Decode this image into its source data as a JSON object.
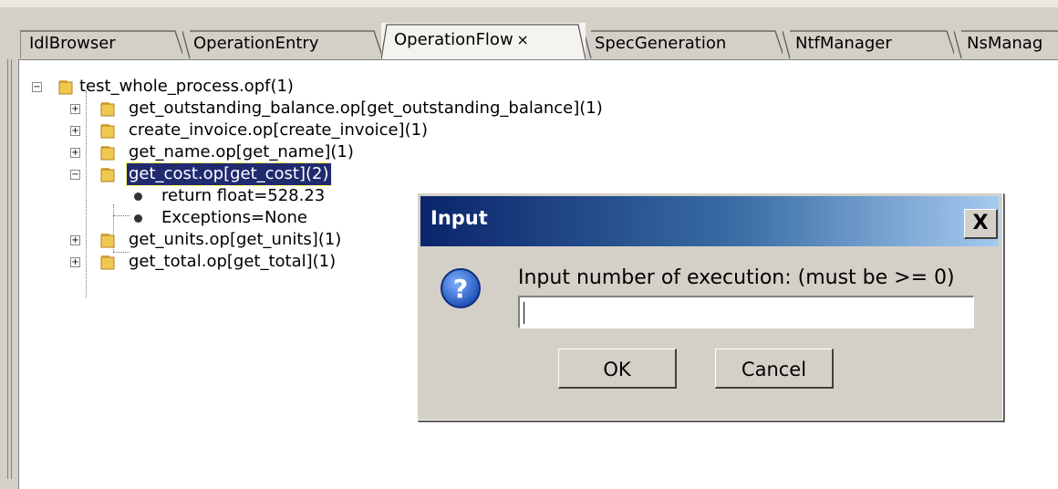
{
  "tabs": [
    {
      "label": "IdlBrowser",
      "active": false
    },
    {
      "label": "OperationEntry",
      "active": false
    },
    {
      "label": "OperationFlow",
      "active": true,
      "close": "×"
    },
    {
      "label": "SpecGeneration",
      "active": false
    },
    {
      "label": "NtfManager",
      "active": false
    },
    {
      "label": "NsManag",
      "active": false
    }
  ],
  "tree": {
    "root": "test_whole_process.opf(1)",
    "items": [
      {
        "label": "get_outstanding_balance.op[get_outstanding_balance](1)"
      },
      {
        "label": "create_invoice.op[create_invoice](1)"
      },
      {
        "label": "get_name.op[get_name](1)"
      },
      {
        "label": "get_cost.op[get_cost](2)",
        "selected": true,
        "children": [
          "return float=528.23",
          "Exceptions=None"
        ]
      },
      {
        "label": "get_units.op[get_units](1)"
      },
      {
        "label": "get_total.op[get_total](1)"
      }
    ]
  },
  "dialog": {
    "title": "Input",
    "close_glyph": "X",
    "icon": "question-icon",
    "prompt": "Input number of execution: (must be >= 0)",
    "input_value": "",
    "ok_label": "OK",
    "cancel_label": "Cancel"
  },
  "colors": {
    "selection": "#1f2a6f",
    "title_gradient_start": "#0a246a",
    "title_gradient_end": "#a6caf0"
  }
}
